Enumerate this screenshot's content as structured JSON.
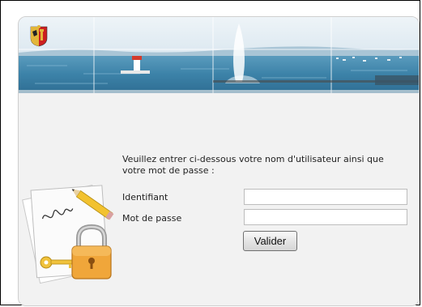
{
  "login": {
    "intro_text": "Veuillez entrer ci-dessous votre nom d'utilisateur ainsi que votre mot de passe :",
    "identifiant_label": "Identifiant",
    "identifiant_value": "",
    "password_label": "Mot de passe",
    "password_value": "",
    "submit_label": "Valider"
  },
  "colors": {
    "banner_sky": "#d9e7f0",
    "banner_water": "#3f86ab",
    "panel_bg": "#f2f2f2",
    "crest_red": "#cc1f1f",
    "crest_gold": "#e2b63a"
  },
  "icons": [
    "geneva-crest-icon",
    "padlock-key-document-icon"
  ]
}
